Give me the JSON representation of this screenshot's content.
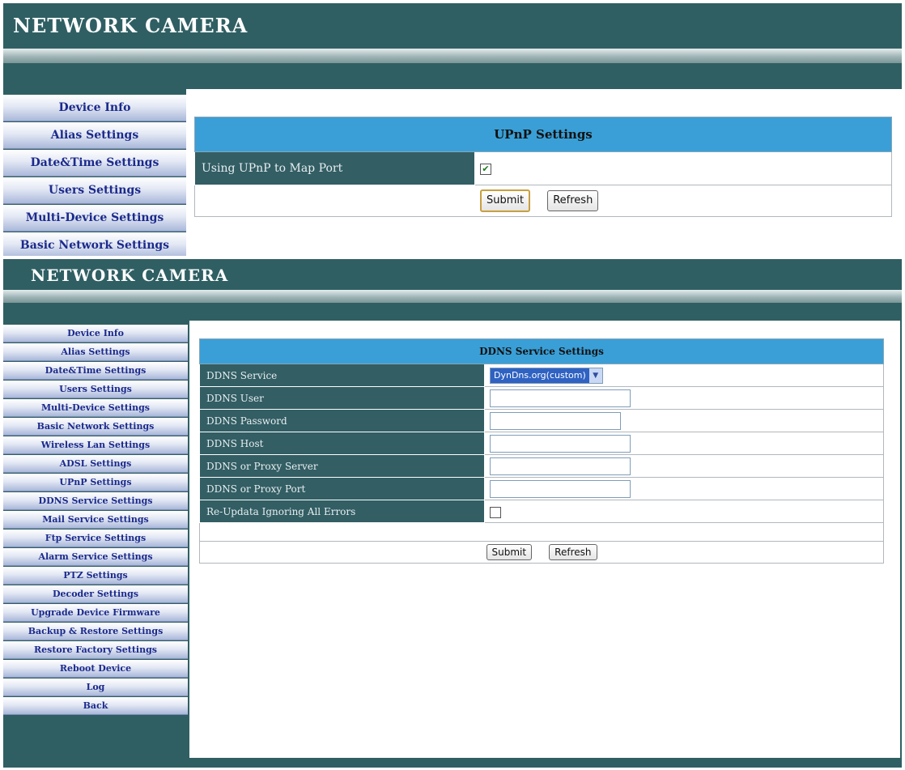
{
  "upnp_screen": {
    "banner": "NETWORK CAMERA",
    "menu": [
      "Device Info",
      "Alias Settings",
      "Date&Time Settings",
      "Users Settings",
      "Multi-Device Settings",
      "Basic Network Settings"
    ],
    "form_title": "UPnP Settings",
    "field_label": "Using UPnP to Map Port",
    "checkbox_mark": "✔",
    "submit_label": "Submit",
    "refresh_label": "Refresh"
  },
  "ddns_screen": {
    "banner": "NETWORK CAMERA",
    "menu": [
      "Device Info",
      "Alias Settings",
      "Date&Time Settings",
      "Users Settings",
      "Multi-Device Settings",
      "Basic Network Settings",
      "Wireless Lan Settings",
      "ADSL Settings",
      "UPnP Settings",
      "DDNS Service Settings",
      "Mail Service Settings",
      "Ftp Service Settings",
      "Alarm Service Settings",
      "PTZ Settings",
      "Decoder Settings",
      "Upgrade Device Firmware",
      "Backup & Restore Settings",
      "Restore Factory Settings",
      "Reboot Device",
      "Log",
      "Back"
    ],
    "form_title": "DDNS Service Settings",
    "fields": {
      "service_label": "DDNS Service",
      "service_value": "DynDns.org(custom)",
      "user_label": "DDNS User",
      "password_label": "DDNS Password",
      "host_label": "DDNS Host",
      "proxy_server_label": "DDNS or Proxy Server",
      "proxy_port_label": "DDNS or Proxy Port",
      "reupdate_label": "Re-Updata Ignoring All Errors"
    },
    "submit_label": "Submit",
    "refresh_label": "Refresh"
  }
}
